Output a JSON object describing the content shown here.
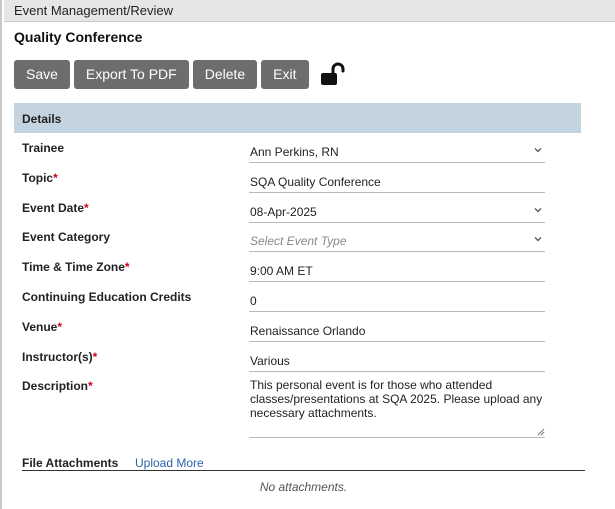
{
  "window": {
    "title": "Event Management/Review"
  },
  "event": {
    "name": "Quality Conference"
  },
  "toolbar": {
    "save_label": "Save",
    "export_label": "Export To PDF",
    "delete_label": "Delete",
    "exit_label": "Exit",
    "lock_icon": "unlocked-padlock"
  },
  "details": {
    "header": "Details",
    "trainee": {
      "label": "Trainee",
      "value": "Ann Perkins, RN",
      "required": false
    },
    "topic": {
      "label": "Topic",
      "value": "SQA Quality Conference",
      "required": true
    },
    "event_date": {
      "label": "Event Date",
      "value": "08-Apr-2025",
      "required": true
    },
    "event_category": {
      "label": "Event Category",
      "placeholder": "Select Event Type",
      "required": false
    },
    "time_zone": {
      "label": "Time & Time Zone",
      "value": "9:00 AM ET",
      "required": true
    },
    "ce_credits": {
      "label": "Continuing Education Credits",
      "value": "0",
      "required": false
    },
    "venue": {
      "label": "Venue",
      "value": "Renaissance Orlando",
      "required": true
    },
    "instructors": {
      "label": "Instructor(s)",
      "value": "Various",
      "required": true
    },
    "description": {
      "label": "Description",
      "value": "This personal event is for those who attended classes/presentations at SQA 2025. Please upload any necessary attachments.",
      "required": true
    },
    "required_marker": "*"
  },
  "attachments": {
    "label": "File Attachments",
    "upload_link": "Upload More",
    "empty_text": "No attachments."
  },
  "colors": {
    "button_bg": "#6d6d6d",
    "section_header_bg": "#c4d3e0",
    "required": "#d0021b",
    "link": "#2b63a9"
  }
}
